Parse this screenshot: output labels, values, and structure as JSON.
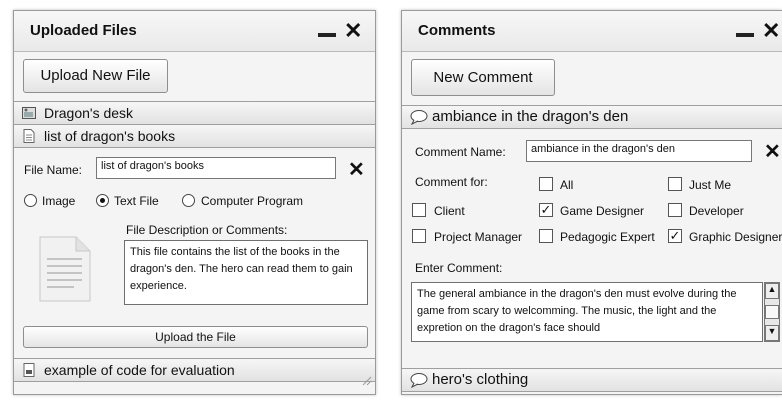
{
  "left_panel": {
    "title": "Uploaded Files",
    "upload_new_label": "Upload New File",
    "files": [
      {
        "name": "Dragon's desk",
        "icon": "image-file-icon"
      },
      {
        "name": "list of dragon's books",
        "icon": "text-file-icon"
      },
      {
        "name": "example of code for evaluation",
        "icon": "program-file-icon"
      }
    ],
    "file_name_label": "File Name:",
    "file_name_value": "list of dragon's books",
    "type_options": [
      "Image",
      "Text File",
      "Computer Program"
    ],
    "selected_type": "Text File",
    "desc_label": "File Description or Comments:",
    "desc_value": "This file contains the list of the books in the dragon's den. The hero can read them to gain experience.",
    "upload_file_label": "Upload the File"
  },
  "right_panel": {
    "title": "Comments",
    "new_comment_label": "New Comment",
    "comments": [
      {
        "name": "ambiance in the dragon's den"
      },
      {
        "name": "hero's clothing"
      }
    ],
    "comment_name_label": "Comment Name:",
    "comment_name_value": "ambiance in the dragon's den",
    "comment_for_label": "Comment for:",
    "recipients": [
      {
        "label": "All",
        "checked": false
      },
      {
        "label": "Just Me",
        "checked": false
      },
      {
        "label": "Client",
        "checked": false
      },
      {
        "label": "Game Designer",
        "checked": true
      },
      {
        "label": "Developer",
        "checked": false
      },
      {
        "label": "Project Manager",
        "checked": false
      },
      {
        "label": "Pedagogic Expert",
        "checked": false
      },
      {
        "label": "Graphic Designer",
        "checked": true
      }
    ],
    "enter_comment_label": "Enter Comment:",
    "comment_text": "The general ambiance in the dragon's den must evolve during the game from scary to welcomming. The music, the light and the expretion on the dragon's face should"
  },
  "icons": {
    "minimize": "minimize-icon",
    "close": "close-icon",
    "comment": "speech-bubble-icon"
  }
}
